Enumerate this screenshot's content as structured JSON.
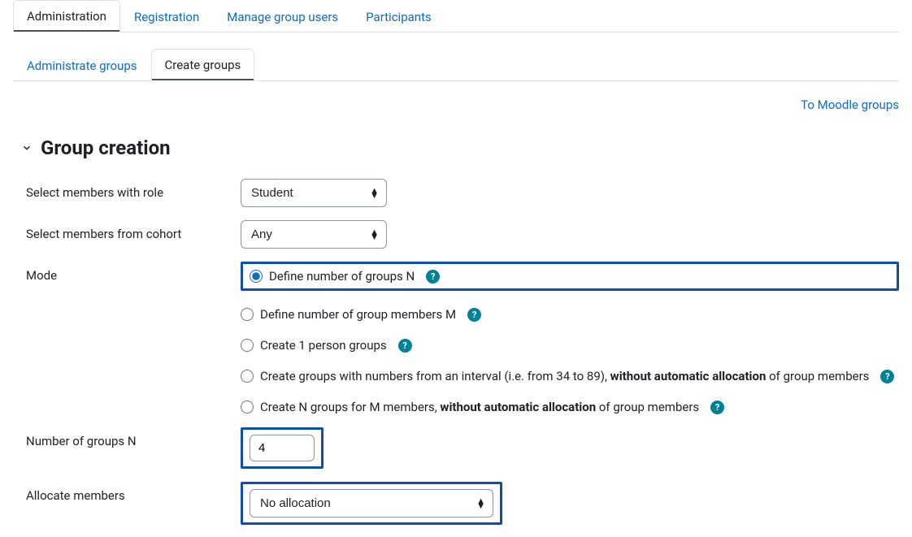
{
  "tabs_primary": [
    {
      "label": "Administration",
      "active": true
    },
    {
      "label": "Registration",
      "active": false
    },
    {
      "label": "Manage group users",
      "active": false
    },
    {
      "label": "Participants",
      "active": false
    }
  ],
  "tabs_secondary": [
    {
      "label": "Administrate groups",
      "active": false
    },
    {
      "label": "Create groups",
      "active": true
    }
  ],
  "link_to_moodle_groups": "To Moodle groups",
  "section_title": "Group creation",
  "labels": {
    "select_role": "Select members with role",
    "select_cohort": "Select members from cohort",
    "mode": "Mode",
    "num_groups": "Number of groups N",
    "allocate": "Allocate members"
  },
  "selects": {
    "role": {
      "value": "Student"
    },
    "cohort": {
      "value": "Any"
    },
    "allocate": {
      "value": "No allocation"
    }
  },
  "mode_options": [
    {
      "label_pre": "Define number of groups N",
      "bold": "",
      "label_post": "",
      "help": true,
      "checked": true
    },
    {
      "label_pre": "Define number of group members M",
      "bold": "",
      "label_post": "",
      "help": true,
      "checked": false
    },
    {
      "label_pre": "Create 1 person groups",
      "bold": "",
      "label_post": "",
      "help": true,
      "checked": false
    },
    {
      "label_pre": "Create groups with numbers from an interval (i.e. from 34 to 89), ",
      "bold": "without automatic allocation",
      "label_post": " of group members",
      "help": true,
      "checked": false
    },
    {
      "label_pre": "Create N groups for M members, ",
      "bold": "without automatic allocation",
      "label_post": " of group members",
      "help": true,
      "checked": false
    }
  ],
  "num_groups_value": "4",
  "help_glyph": "?"
}
